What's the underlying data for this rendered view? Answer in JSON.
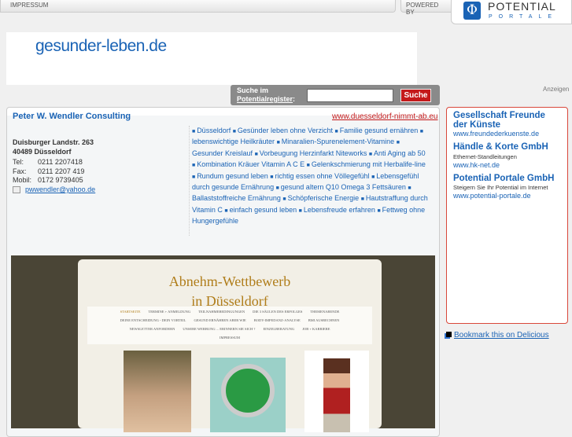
{
  "topbar": {
    "impressum": "IMPRESSUM",
    "powered_by": "POWERED BY"
  },
  "potential_logo": {
    "symbol": "Φ",
    "line1": "POTENTIAL",
    "line2": "PORTALE"
  },
  "site_logo": "gesunder-leben.de",
  "search": {
    "label_line1": "Suche im",
    "label_link": "Potentialregister",
    "label_suffix": ":",
    "value": "",
    "button": "Suche"
  },
  "anzeigen": "Anzeigen",
  "listing": {
    "company": "Peter W. Wendler Consulting",
    "website": "www.duesseldorf-nimmt-ab.eu",
    "street": "Duisburger Landstr. 263",
    "city": "40489 Düsseldorf",
    "contacts": [
      {
        "label": "Tel:",
        "value": "0211 2207418"
      },
      {
        "label": "Fax:",
        "value": "0211 2207 419"
      },
      {
        "label": "Mobil:",
        "value": "0172 9739405"
      }
    ],
    "email": "pwwendler@yahoo.de",
    "tags": [
      "Düsseldorf",
      "Gesünder leben ohne Verzicht",
      "Familie gesund ernähren",
      "lebenswichtige Heilkräuter",
      "Minaralien-Spurenelement-Vitamine",
      "Gesunder Kreislauf",
      "Vorbeugung Herzinfarkt Niteworks",
      "Anti Aging ab 50",
      "Kombination Kräuer Vitamin A C E",
      "Gelenkschmierung mit Herbalife-line",
      "Rundum gesund leben",
      "richtig essen ohne Völlegefühl",
      "Lebensgefühl durch gesunde Ernährung",
      "gesund altern Q10 Omega 3 Fettsäuren",
      "Ballaststoffreiche Ernährung",
      "Schöpferische Energie",
      "Hautstraffung durch Vitamin C",
      "einfach gesund leben",
      "Lebensfreude erfahren",
      "Fettweg ohne Hungergefühle"
    ]
  },
  "screenshot": {
    "title1": "Abnehm-Wettbewerb",
    "title2": "in Düsseldorf",
    "nav": [
      "STARTSEITE",
      "TERMINE + ANMELDUNG",
      "TEILNAHMEBEDINGUNGEN",
      "DIE 3 SÄULEN DES ERFOLGES",
      "THEMENABENDE",
      "DEINE ENTSCHEIDUNG - DEIN VORTEIL",
      "GESUND ERNÄHREN ABER WIE",
      "BODY-IMPEDANZ-ANALYSE",
      "BMI AUSRECHNEN",
      "NEWSLETTER ANFORDERN",
      "UNSERE WERBUNG ... ERINNERN SIE SICH ?",
      "EINZELBERATUNG",
      "JOB + KARRIERE",
      "IMPRESSUM"
    ]
  },
  "ads": [
    {
      "title": "Gesellschaft Freunde der Künste",
      "desc": "",
      "url": "www.freundederkuenste.de"
    },
    {
      "title": "Händle & Korte GmbH",
      "desc": "Ethernet-Standleitungen",
      "url": "www.hk-net.de"
    },
    {
      "title": "Potential Portale GmbH",
      "desc": "Steigern Sie Ihr Potential im Internet",
      "url": "www.potential-portale.de"
    }
  ],
  "bookmark": "Bookmark this on Delicious",
  "colors": {
    "brand_blue": "#1a63b5",
    "accent_red": "#c4191a"
  }
}
